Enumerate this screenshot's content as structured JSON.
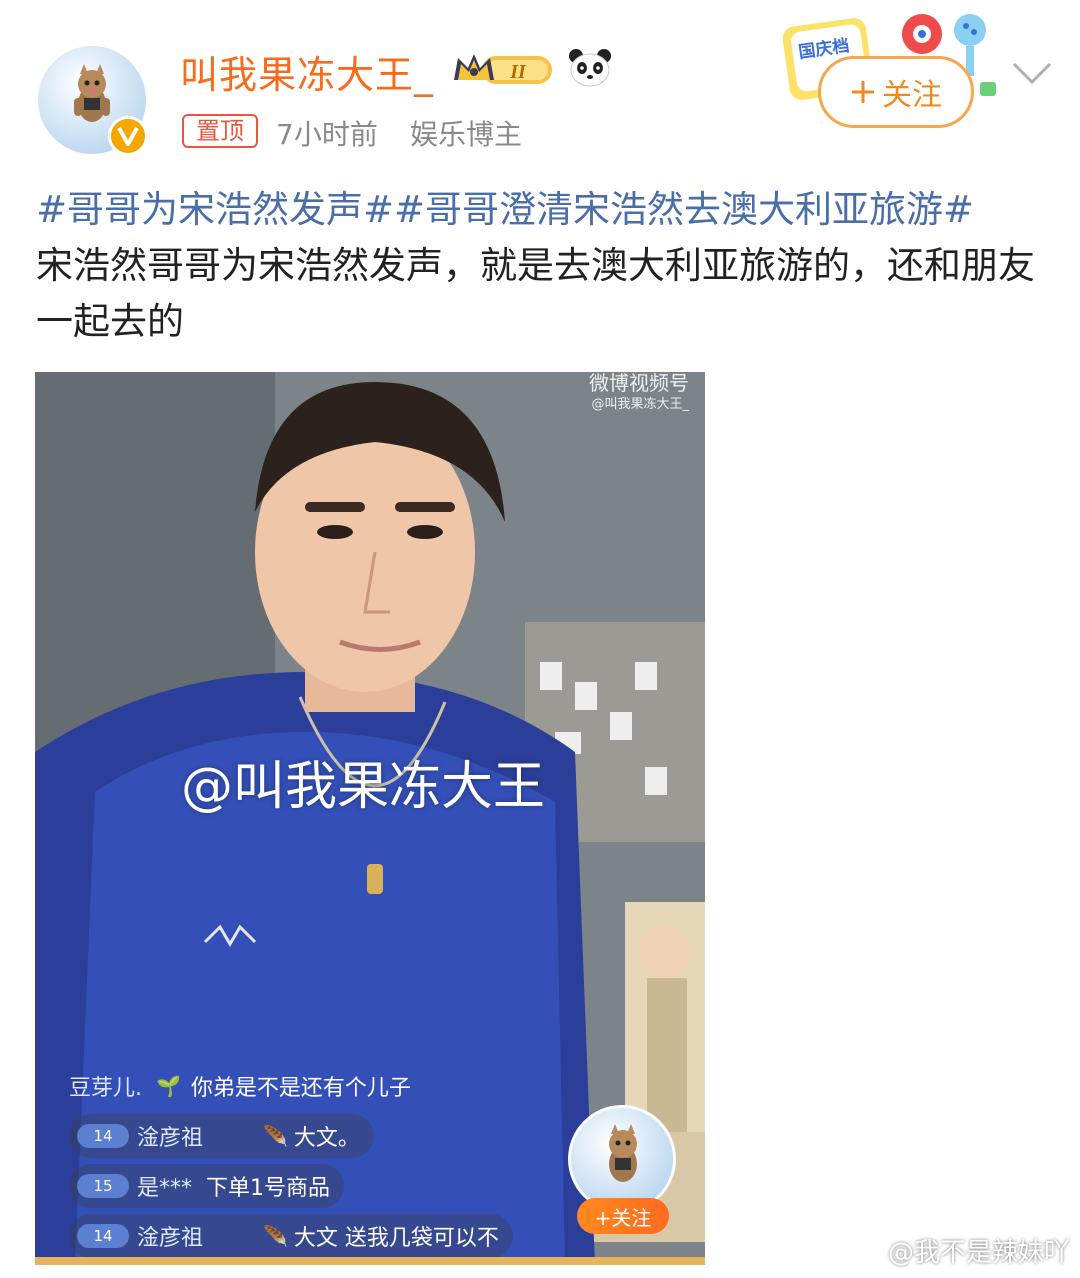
{
  "header": {
    "username": "叫我果冻大王_",
    "level_badge": "II",
    "pin_label": "置顶",
    "time": "7小时前",
    "role": "娱乐博主",
    "follow_label": "关注",
    "promo_text": "国庆档"
  },
  "post": {
    "topic1": "#哥哥为宋浩然发声#",
    "topic2": "#哥哥澄清宋浩然去澳大利亚旅游#",
    "body": "宋浩然哥哥为宋浩然发声，就是去澳大利亚旅游的，还和朋友一起去的"
  },
  "video": {
    "watermark_title": "微博视频号",
    "watermark_handle": "@叫我果冻大王_",
    "overlay_handle": "@叫我果冻大王",
    "follow_label": "+关注",
    "chat": [
      {
        "level": "",
        "name": "豆芽儿.",
        "message": "你弟是不是还有个儿子"
      },
      {
        "level": "14",
        "name": "淦彦祖",
        "message": "大文。"
      },
      {
        "level": "15",
        "name": "是***",
        "message": "下单1号商品"
      },
      {
        "level": "14",
        "name": "淦彦祖",
        "message": "大文 送我几袋可以不"
      }
    ]
  },
  "footer": {
    "watermark": "@我不是辣妹吖"
  },
  "colors": {
    "username": "#f76b1c",
    "topic": "#4a6ea9",
    "accent": "#f08a20"
  }
}
